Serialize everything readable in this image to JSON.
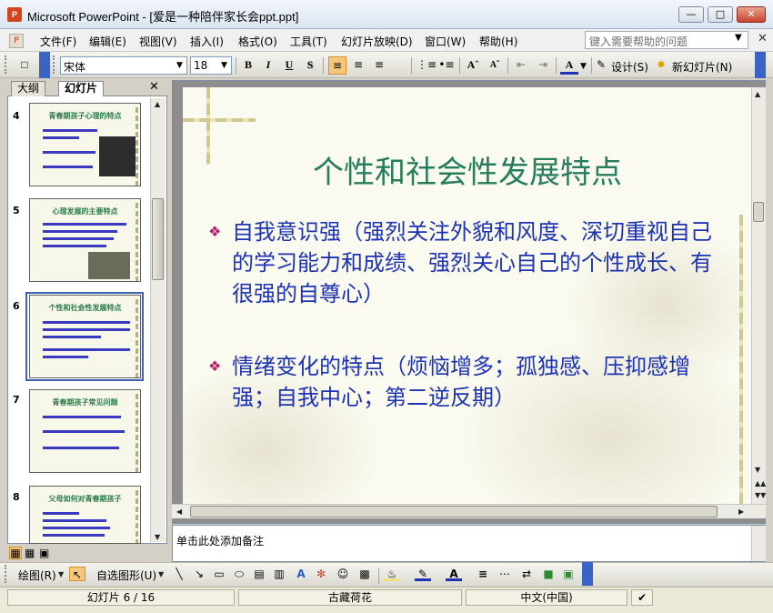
{
  "window": {
    "title": "Microsoft PowerPoint - [爱是一种陪伴家长会ppt.ppt]",
    "app_icon_text": "P"
  },
  "menu": {
    "items": [
      "文件(F)",
      "编辑(E)",
      "视图(V)",
      "插入(I)",
      "格式(O)",
      "工具(T)",
      "幻灯片放映(D)",
      "窗口(W)",
      "帮助(H)"
    ],
    "help_placeholder": "键入需要帮助的问题"
  },
  "toolbar": {
    "font_name": "宋体",
    "font_size": "18",
    "bold": "B",
    "italic": "I",
    "underline": "U",
    "shadow": "S",
    "design_label": "设计(S)",
    "new_slide_label": "新幻灯片(N)"
  },
  "left_pane": {
    "tab_outline": "大纲",
    "tab_slides": "幻灯片",
    "thumbnails": [
      {
        "number": "4",
        "title": "青春期孩子心理的特点"
      },
      {
        "number": "5",
        "title": "心理发展的主要特点"
      },
      {
        "number": "6",
        "title": "个性和社会性发展特点"
      },
      {
        "number": "7",
        "title": "青春期孩子常见问题"
      },
      {
        "number": "8",
        "title": "父母如何对青春期孩子"
      }
    ],
    "selected": "6"
  },
  "slide": {
    "title": "个性和社会性发展特点",
    "bullets": [
      "自我意识强（强烈关注外貌和风度、深切重视自己的学习能力和成绩、强烈关心自己的个性成长、有很强的自尊心）",
      "情绪变化的特点（烦恼增多；孤独感、压抑感增强；自我中心；第二逆反期）"
    ],
    "title_color": "#287d5c",
    "body_color": "#1d33b3",
    "bullet_color": "#b71f68"
  },
  "notes": {
    "placeholder": "单击此处添加备注"
  },
  "drawing_toolbar": {
    "draw_label": "绘图(R)",
    "autoshapes_label": "自选图形(U)"
  },
  "status": {
    "slide_position": "幻灯片 6 / 16",
    "design_name": "古藏荷花",
    "language": "中文(中国)"
  }
}
